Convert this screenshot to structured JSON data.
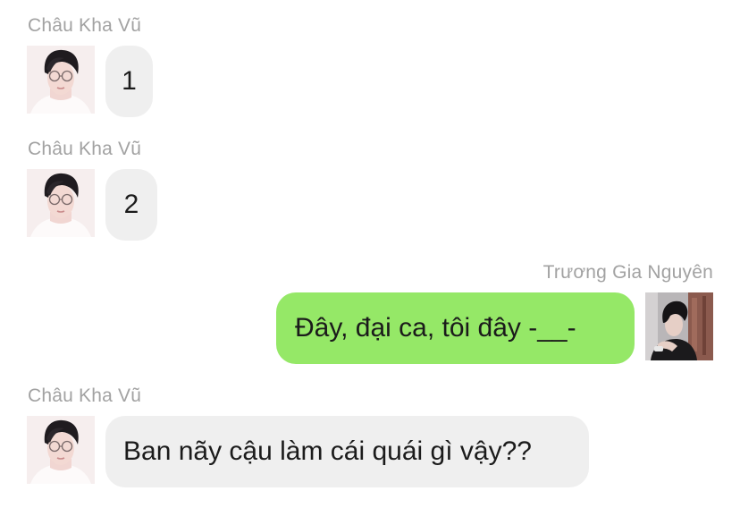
{
  "conversation": {
    "messages": [
      {
        "sender": "Châu Kha Vũ",
        "side": "left",
        "avatar": "avatar-glasses-boy",
        "text": "1"
      },
      {
        "sender": "Châu Kha Vũ",
        "side": "left",
        "avatar": "avatar-glasses-boy",
        "text": "2"
      },
      {
        "sender": "Trương Gia Nguyên",
        "side": "right",
        "avatar": "avatar-photo-boy",
        "text": "Đây, đại ca, tôi đây -__-"
      },
      {
        "sender": "Châu Kha Vũ",
        "side": "left",
        "avatar": "avatar-glasses-boy",
        "text": "Ban nãy cậu làm cái quái gì vậy??"
      }
    ]
  },
  "colors": {
    "incoming_bubble": "#efefef",
    "outgoing_bubble": "#95e867",
    "sender_name": "#a2a2a2",
    "background": "#ffffff"
  }
}
